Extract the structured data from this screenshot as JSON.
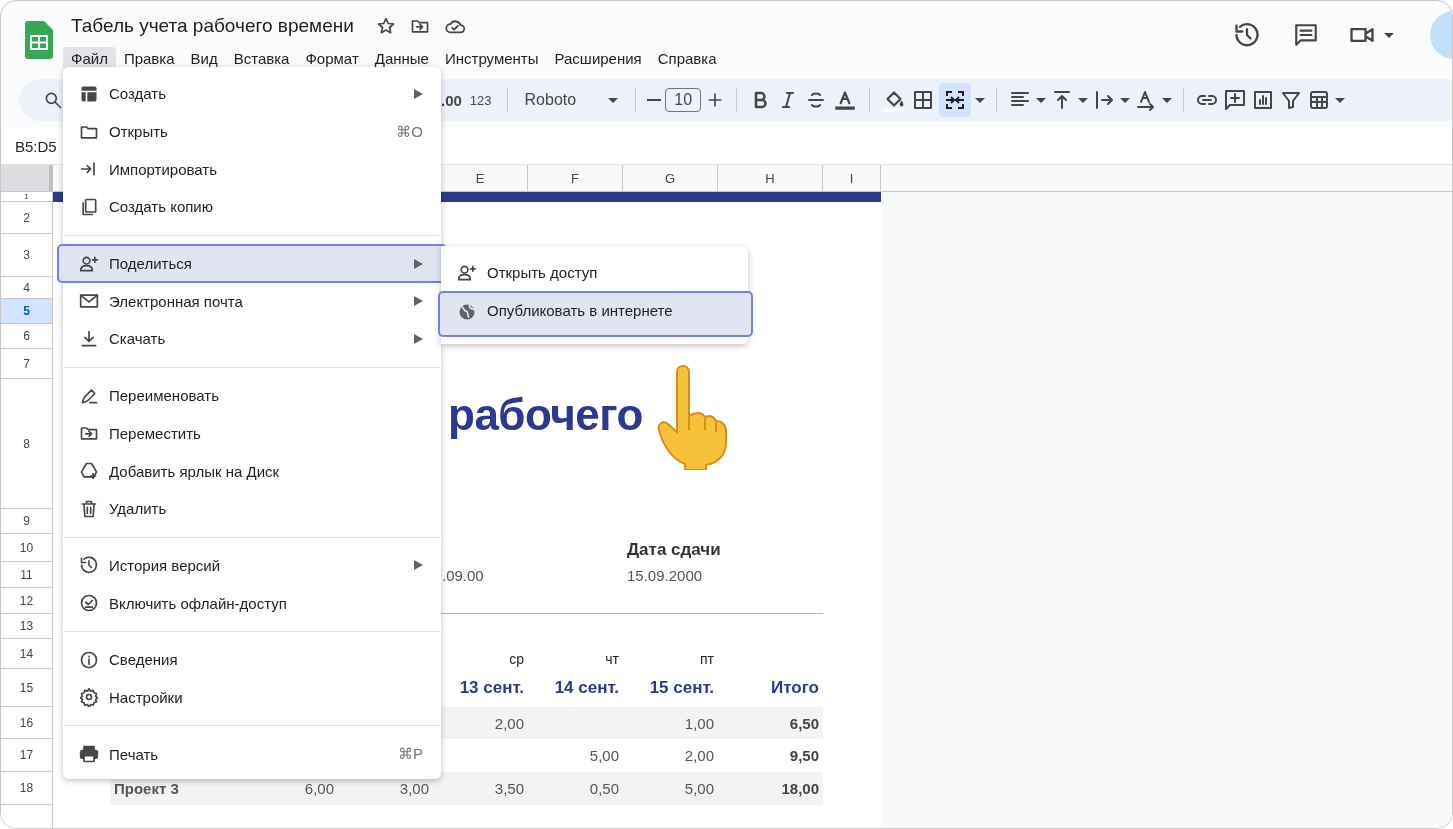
{
  "document": {
    "title": "Табель учета рабочего времени"
  },
  "menu_bar": [
    {
      "label": "Файл",
      "selected": true
    },
    {
      "label": "Правка",
      "selected": false
    },
    {
      "label": "Вид",
      "selected": false
    },
    {
      "label": "Вставка",
      "selected": false
    },
    {
      "label": "Формат",
      "selected": false
    },
    {
      "label": "Данные",
      "selected": false
    },
    {
      "label": "Инструменты",
      "selected": false
    },
    {
      "label": "Расширения",
      "selected": false
    },
    {
      "label": "Справка",
      "selected": false
    }
  ],
  "toolbar": {
    "decimal_label": ".00",
    "number_format": "123",
    "font": "Roboto",
    "font_size": "10",
    "merge_cells_active": true
  },
  "name_box": "B5:D5",
  "sheet": {
    "column_headers": [
      "E",
      "F",
      "G",
      "H",
      "I"
    ],
    "rows": [
      {
        "label": "1",
        "selected": false
      },
      {
        "label": "2",
        "selected": false
      },
      {
        "label": "3",
        "selected": false
      },
      {
        "label": "4",
        "selected": false
      },
      {
        "label": "5",
        "selected": true
      },
      {
        "label": "6",
        "selected": false
      },
      {
        "label": "7",
        "selected": false
      },
      {
        "label": "8",
        "selected": false
      },
      {
        "label": "9",
        "selected": false
      },
      {
        "label": "10",
        "selected": false
      },
      {
        "label": "11",
        "selected": false
      },
      {
        "label": "12",
        "selected": false
      },
      {
        "label": "13",
        "selected": false
      },
      {
        "label": "14",
        "selected": false
      },
      {
        "label": "15",
        "selected": false
      },
      {
        "label": "16",
        "selected": false
      },
      {
        "label": "17",
        "selected": false
      },
      {
        "label": "18",
        "selected": false
      }
    ],
    "title_fragment": "рабочего",
    "start_date_fragment": ".09.00",
    "due_date": {
      "label": "Дата сдачи",
      "value": "15.09.2000"
    },
    "day_headers": [
      {
        "weekday": "ср",
        "date": "13 сент."
      },
      {
        "weekday": "чт",
        "date": "14 сент."
      },
      {
        "weekday": "пт",
        "date": "15 сент."
      }
    ],
    "total_header": "Итого",
    "projects": [
      {
        "wed": "2,00",
        "fri": "1,00",
        "total": "6,50"
      },
      {
        "thu": "5,00",
        "fri": "2,00",
        "total": "9,50"
      },
      {
        "name": "Проект 3",
        "column_c": "6,00",
        "column_d": "3,00",
        "wed": "3,50",
        "thu": "0,50",
        "fri": "5,00",
        "total": "18,00"
      }
    ]
  },
  "file_menu": {
    "items": [
      {
        "kind": "item",
        "label": "Создать",
        "submenu": true,
        "highlighted": false
      },
      {
        "kind": "item",
        "label": "Открыть",
        "shortcut": "⌘O",
        "submenu": false,
        "highlighted": false
      },
      {
        "kind": "item",
        "label": "Импортировать",
        "submenu": false,
        "highlighted": false
      },
      {
        "kind": "item",
        "label": "Создать копию",
        "submenu": false,
        "highlighted": false
      },
      {
        "kind": "separator"
      },
      {
        "kind": "item",
        "label": "Поделиться",
        "submenu": true,
        "highlighted": true
      },
      {
        "kind": "item",
        "label": "Электронная почта",
        "submenu": true,
        "highlighted": false
      },
      {
        "kind": "item",
        "label": "Скачать",
        "submenu": true,
        "highlighted": false
      },
      {
        "kind": "separator"
      },
      {
        "kind": "item",
        "label": "Переименовать",
        "submenu": false,
        "highlighted": false
      },
      {
        "kind": "item",
        "label": "Переместить",
        "submenu": false,
        "highlighted": false
      },
      {
        "kind": "item",
        "label": "Добавить ярлык на Диск",
        "submenu": false,
        "highlighted": false
      },
      {
        "kind": "item",
        "label": "Удалить",
        "submenu": false,
        "highlighted": false
      },
      {
        "kind": "separator"
      },
      {
        "kind": "item",
        "label": "История версий",
        "submenu": true,
        "highlighted": false
      },
      {
        "kind": "item",
        "label": "Включить офлайн-доступ",
        "submenu": false,
        "highlighted": false
      },
      {
        "kind": "separator"
      },
      {
        "kind": "item",
        "label": "Сведения",
        "submenu": false,
        "highlighted": false
      },
      {
        "kind": "item",
        "label": "Настройки",
        "submenu": false,
        "highlighted": false
      },
      {
        "kind": "separator"
      },
      {
        "kind": "item",
        "label": "Печать",
        "shortcut": "⌘P",
        "submenu": false,
        "highlighted": false
      }
    ]
  },
  "share_submenu": {
    "items": [
      {
        "label": "Открыть доступ",
        "highlighted": false
      },
      {
        "label": "Опубликовать в интернете",
        "highlighted": true
      }
    ]
  }
}
